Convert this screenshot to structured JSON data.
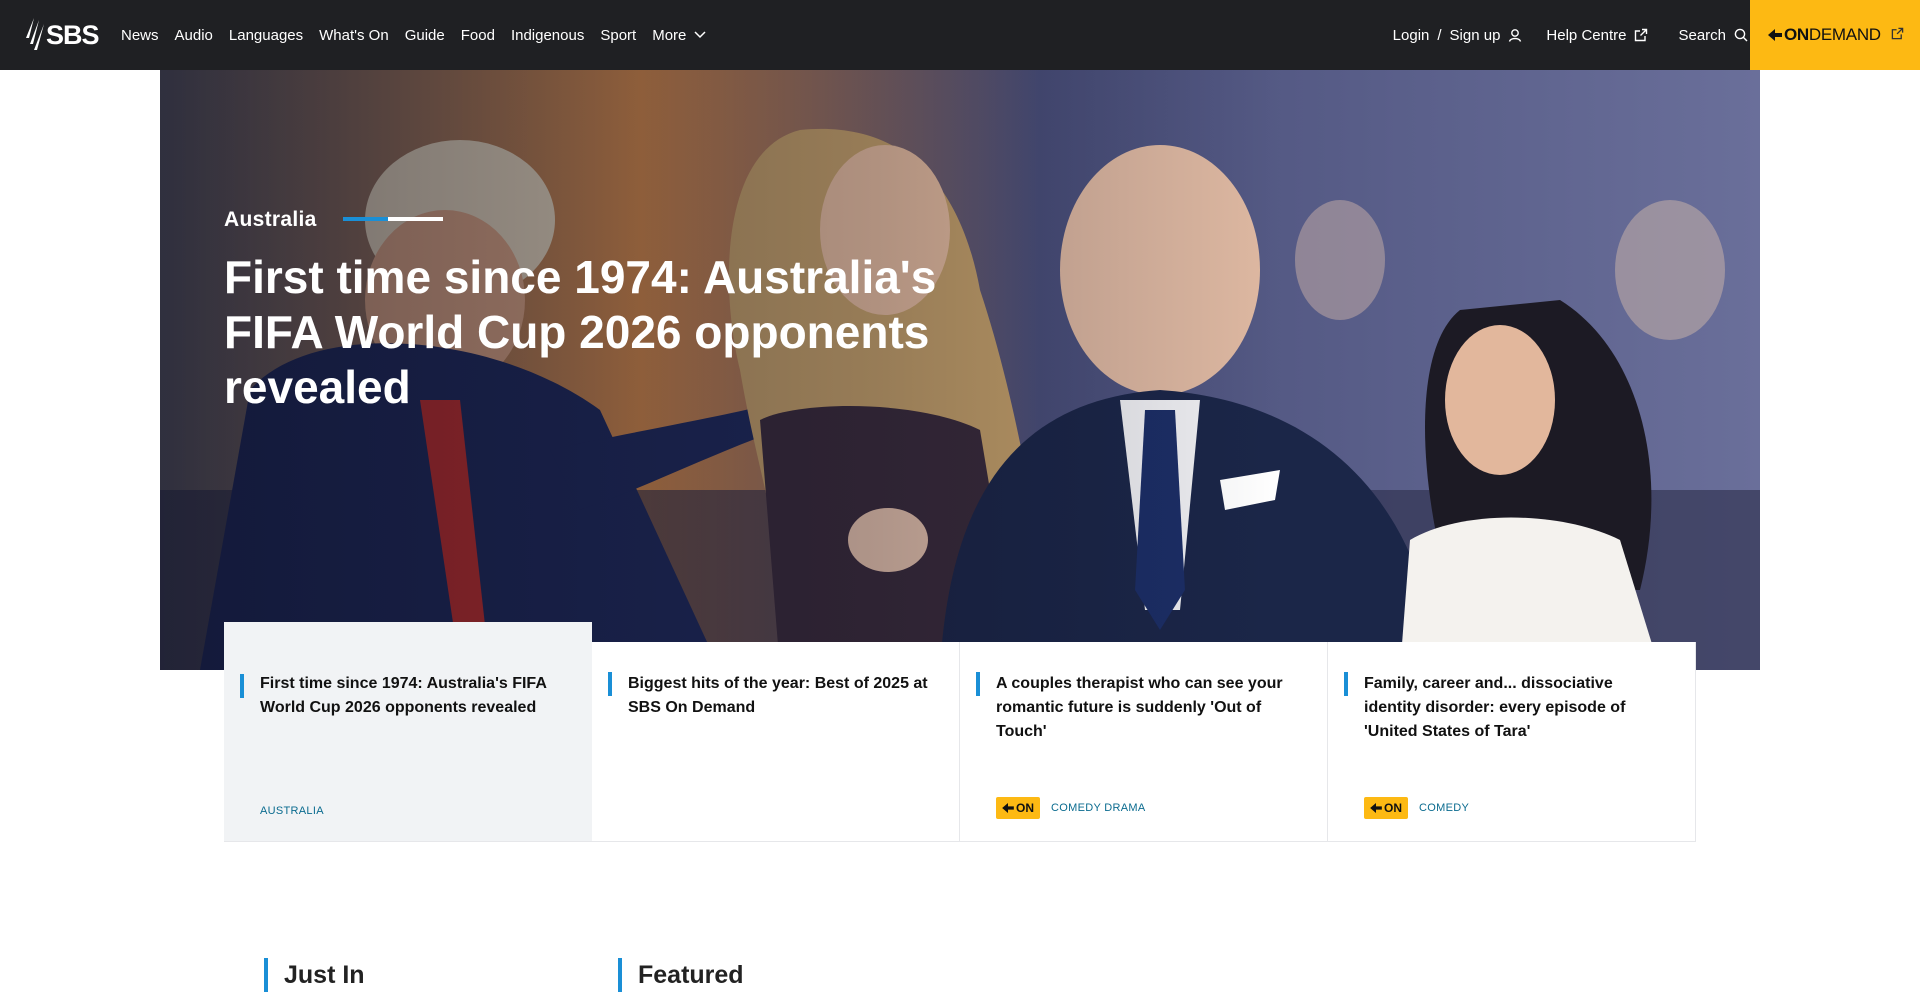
{
  "brand": {
    "logo_text": "SBS",
    "accent": "#1a8fd6",
    "ondemand_color": "#fdb913",
    "nav_bg": "#1f2023"
  },
  "nav": {
    "items": [
      "News",
      "Audio",
      "Languages",
      "What's On",
      "Guide",
      "Food",
      "Indigenous",
      "Sport",
      "More"
    ],
    "login": "Login",
    "separator": "/",
    "signup": "Sign up",
    "help": "Help Centre",
    "search": "Search",
    "ondemand_prefix": "ON",
    "ondemand_suffix": "DEMAND"
  },
  "hero": {
    "category": "Australia",
    "title": "First time since 1974: Australia's FIFA World Cup 2026 opponents revealed",
    "slide_progress": 0.45
  },
  "cards": [
    {
      "title": "First time since 1974: Australia's FIFA World Cup 2026 opponents revealed",
      "tag": "AUSTRALIA",
      "badge": "",
      "active": true
    },
    {
      "title": "Biggest hits of the year: Best of 2025 at SBS On Demand",
      "tag": "",
      "badge": "",
      "active": false
    },
    {
      "title": "A couples therapist who can see your romantic future is suddenly 'Out of Touch'",
      "tag": "COMEDY DRAMA",
      "badge": "ON",
      "active": false
    },
    {
      "title": "Family, career and... dissociative identity disorder: every episode of 'United States of Tara'",
      "tag": "COMEDY",
      "badge": "ON",
      "active": false
    }
  ],
  "sections": {
    "just_in": "Just In",
    "featured": "Featured"
  }
}
